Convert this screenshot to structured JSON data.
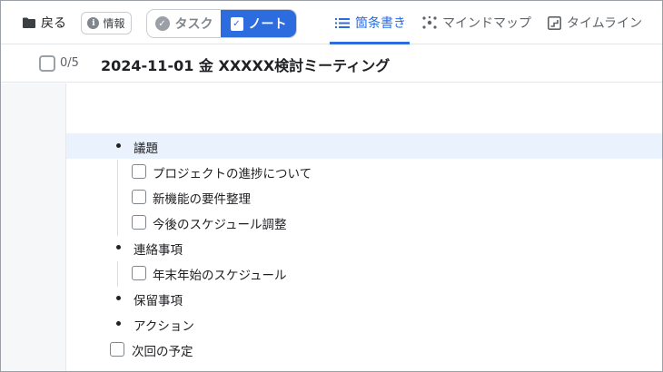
{
  "toolbar": {
    "back_label": "戻る",
    "info_label": "情報",
    "mode_tabs": [
      {
        "label": "タスク",
        "active": false
      },
      {
        "label": "ノート",
        "active": true
      }
    ],
    "view_tabs": [
      {
        "label": "箇条書き",
        "active": true,
        "icon": "list-icon"
      },
      {
        "label": "マインドマップ",
        "active": false,
        "icon": "mindmap-icon"
      },
      {
        "label": "タイムライン",
        "active": false,
        "icon": "timeline-icon"
      }
    ],
    "accent_color": "#2d6cdf"
  },
  "note": {
    "progress_text": "0/5",
    "title": "2024-11-01 金 XXXXX検討ミーティング"
  },
  "outline": [
    {
      "text": "議題",
      "kind": "bullet",
      "highlighted": true
    },
    {
      "text": "プロジェクトの進捗について",
      "kind": "checkbox",
      "checked": false,
      "level": 1
    },
    {
      "text": "新機能の要件整理",
      "kind": "checkbox",
      "checked": false,
      "level": 1
    },
    {
      "text": "今後のスケジュール調整",
      "kind": "checkbox",
      "checked": false,
      "level": 1
    },
    {
      "text": "連絡事項",
      "kind": "bullet"
    },
    {
      "text": "年末年始のスケジュール",
      "kind": "checkbox",
      "checked": false,
      "level": 1
    },
    {
      "text": "保留事項",
      "kind": "bullet"
    },
    {
      "text": "アクション",
      "kind": "bullet"
    },
    {
      "text": "次回の予定",
      "kind": "checkbox",
      "checked": false,
      "level": 0
    }
  ]
}
